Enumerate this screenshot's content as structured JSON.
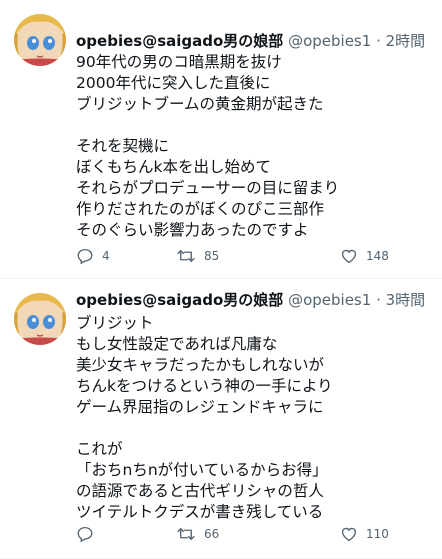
{
  "tweets": [
    {
      "display_name": "opebies@saigado男の娘部",
      "handle": "@opebies1",
      "separator": "·",
      "time": "2時間",
      "lines": [
        "90年代の男のコ暗黒期を抜け",
        "2000年代に突入した直後に",
        "ブリジットブームの黄金期が起きた",
        "",
        "それを契機に",
        "ぼくもちんk本を出し始めて",
        "それらがプロデューサーの目に留まり",
        "作りだされたのがぼくのぴこ三部作",
        "そのぐらい影響力あったのですよ"
      ],
      "replies": "4",
      "retweets": "85",
      "likes": "148"
    },
    {
      "display_name": "opebies@saigado男の娘部",
      "handle": "@opebies1",
      "separator": "·",
      "time": "3時間",
      "lines": [
        "ブリジット",
        "もし女性設定であれば凡庸な",
        "美少女キャラだったかもしれないが",
        "ちんkをつけるという神の一手により",
        "ゲーム界屈指のレジェンドキャラに",
        "",
        "これが",
        "「おちnちnが付いているからお得」",
        "の語源であると古代ギリシャの哲人",
        "ツイテルトクデスが書き残している"
      ],
      "replies": "",
      "retweets": "66",
      "likes": "110"
    }
  ],
  "icons": {
    "reply": "reply-icon",
    "retweet": "retweet-icon",
    "like": "heart-icon",
    "avatar": "avatar"
  },
  "colors": {
    "text": "#0f1419",
    "secondary": "#536471",
    "divider": "#eff3f4"
  }
}
